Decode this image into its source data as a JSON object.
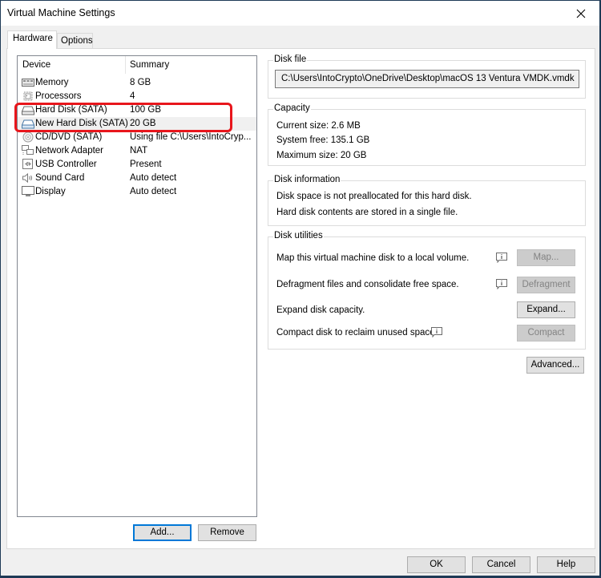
{
  "window": {
    "title": "Virtual Machine Settings"
  },
  "tabs": [
    {
      "label": "Hardware",
      "active": true
    },
    {
      "label": "Options",
      "active": false
    }
  ],
  "device_list": {
    "columns": {
      "device": "Device",
      "summary": "Summary"
    },
    "rows": [
      {
        "name": "Memory",
        "summary": "8 GB",
        "icon": "memory-icon"
      },
      {
        "name": "Processors",
        "summary": "4",
        "icon": "processor-icon"
      },
      {
        "name": "Hard Disk (SATA)",
        "summary": "100 GB",
        "icon": "hard-disk-icon"
      },
      {
        "name": "New Hard Disk (SATA)",
        "summary": "20 GB",
        "icon": "hard-disk-icon",
        "selected": true
      },
      {
        "name": "CD/DVD (SATA)",
        "summary": "Using file C:\\Users\\IntoCryp...",
        "icon": "cd-dvd-icon"
      },
      {
        "name": "Network Adapter",
        "summary": "NAT",
        "icon": "network-adapter-icon"
      },
      {
        "name": "USB Controller",
        "summary": "Present",
        "icon": "usb-icon"
      },
      {
        "name": "Sound Card",
        "summary": "Auto detect",
        "icon": "speaker-icon"
      },
      {
        "name": "Display",
        "summary": "Auto detect",
        "icon": "monitor-icon"
      }
    ],
    "add_label": "Add...",
    "remove_label": "Remove"
  },
  "highlight_color": "#e8161c",
  "disk_file": {
    "label": "Disk file",
    "path": "C:\\Users\\IntoCrypto\\OneDrive\\Desktop\\macOS 13 Ventura VMDK.vmdk"
  },
  "capacity": {
    "label": "Capacity",
    "current_size": "Current size:  2.6 MB",
    "system_free": "System free:  135.1 GB",
    "maximum_size": "Maximum size:  20 GB"
  },
  "disk_information": {
    "label": "Disk information",
    "line1": "Disk space is not preallocated for this hard disk.",
    "line2": "Hard disk contents are stored in a single file."
  },
  "disk_utilities": {
    "label": "Disk utilities",
    "map_text": "Map this virtual machine disk to a local volume.",
    "map_button": "Map...",
    "defrag_text": "Defragment files and consolidate free space.",
    "defrag_button": "Defragment",
    "expand_text": "Expand disk capacity.",
    "expand_button": "Expand...",
    "compact_text": "Compact disk to reclaim unused space.",
    "compact_button": "Compact"
  },
  "advanced_button": "Advanced...",
  "footer": {
    "ok": "OK",
    "cancel": "Cancel",
    "help": "Help"
  }
}
